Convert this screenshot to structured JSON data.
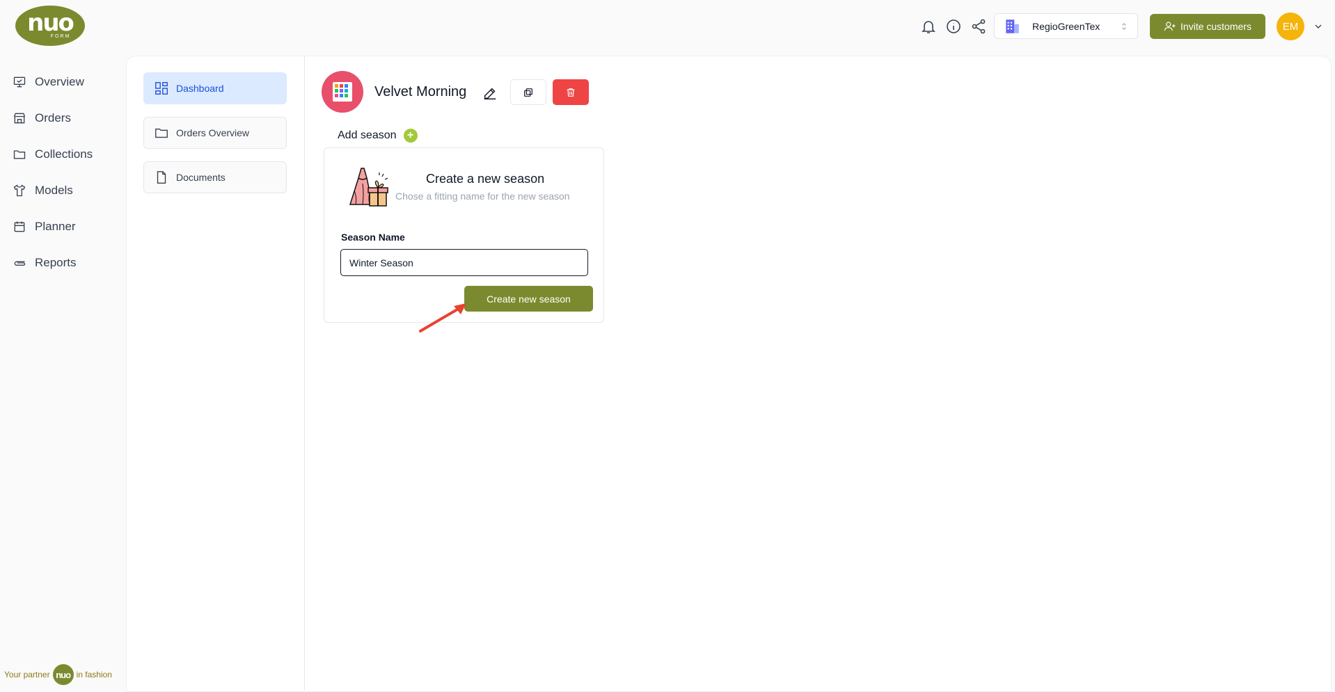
{
  "brand": {
    "logo_text": "nuo",
    "logo_sub": "FORM",
    "footer_prefix": "Your partner",
    "footer_mini": "nuo",
    "footer_suffix": "in fashion"
  },
  "nav": {
    "items": [
      {
        "label": "Overview",
        "icon": "monitor-icon"
      },
      {
        "label": "Orders",
        "icon": "store-icon"
      },
      {
        "label": "Collections",
        "icon": "folder-icon"
      },
      {
        "label": "Models",
        "icon": "shirt-icon"
      },
      {
        "label": "Planner",
        "icon": "calendar-icon"
      },
      {
        "label": "Reports",
        "icon": "clip-icon"
      }
    ]
  },
  "subnav": {
    "items": [
      {
        "label": "Dashboard",
        "icon": "dashboard-icon",
        "active": true
      },
      {
        "label": "Orders Overview",
        "icon": "folder-icon"
      },
      {
        "label": "Documents",
        "icon": "document-icon"
      }
    ]
  },
  "header": {
    "company": "RegioGreenTex",
    "invite_label": "Invite customers",
    "avatar_initials": "EM"
  },
  "collection": {
    "title": "Velvet Morning"
  },
  "season": {
    "add_label": "Add season",
    "card_title": "Create a new season",
    "card_subtitle": "Chose a fitting name for the new season",
    "field_label": "Season Name",
    "field_value": "Winter Season",
    "create_label": "Create new season"
  },
  "colors": {
    "accent": "#7b8a2e",
    "danger": "#ef4444",
    "active_bg": "#dbeafe",
    "avatar": "#f5b40a"
  }
}
